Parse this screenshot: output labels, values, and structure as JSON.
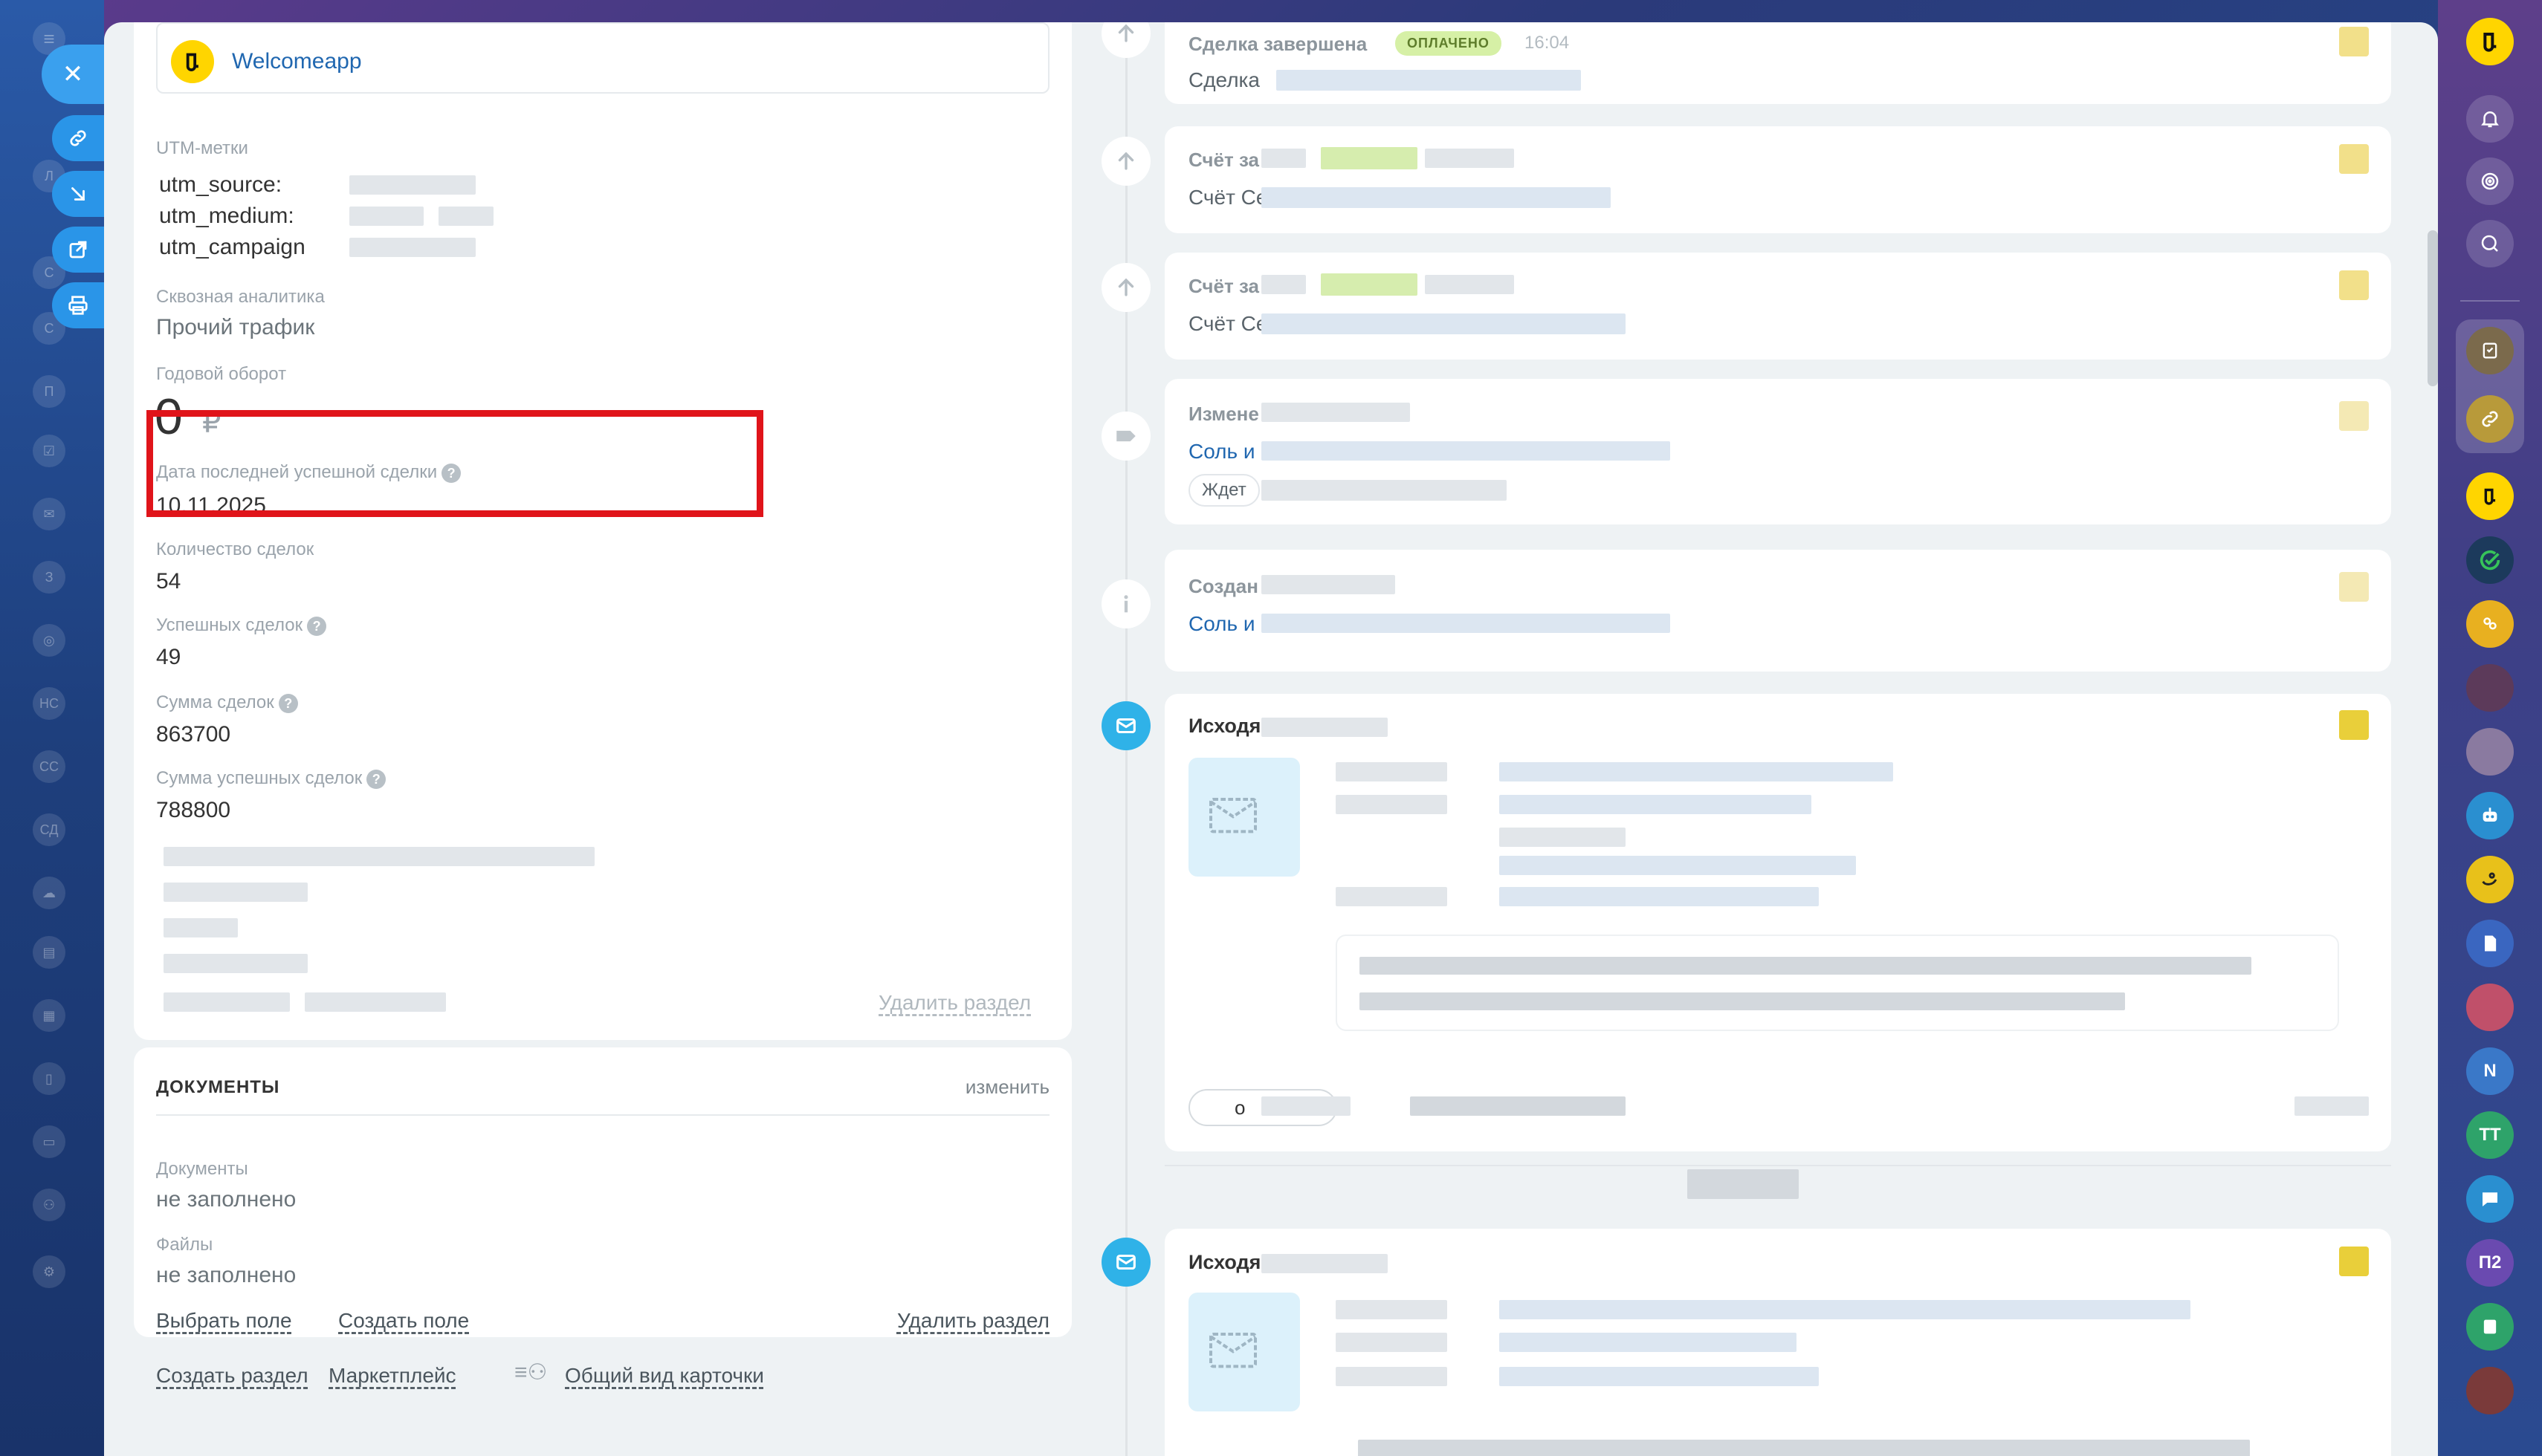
{
  "colors": {
    "accent": "#2fb2e8",
    "highlight": "#e0141a",
    "link": "#2067b0",
    "badge_bg": "#d6f0a6",
    "badge_text": "#5e7d2b"
  },
  "company": {
    "name": "Welcomeapp"
  },
  "utm": {
    "heading": "UTM-метки",
    "source_label": "utm_source:",
    "medium_label": "utm_medium:",
    "campaign_label": "utm_campaign"
  },
  "analytics": {
    "label": "Сквозная аналитика",
    "value": "Прочий трафик"
  },
  "turnover": {
    "label": "Годовой оборот",
    "value": "0",
    "currency": "₽"
  },
  "last_deal": {
    "label": "Дата последней успешной сделки",
    "value": "10.11.2025"
  },
  "deal_count": {
    "label": "Количество сделок",
    "value": "54"
  },
  "successful_deals": {
    "label": "Успешных сделок",
    "value": "49"
  },
  "deals_sum": {
    "label": "Сумма сделок",
    "value": "863700"
  },
  "successful_sum": {
    "label": "Сумма успешных сделок",
    "value": "788800"
  },
  "section_actions": {
    "delete_section": "Удалить раздел"
  },
  "documents": {
    "title": "ДОКУМЕНТЫ",
    "edit": "изменить",
    "docs_label": "Документы",
    "docs_value": "не заполнено",
    "files_label": "Файлы",
    "files_value": "не заполнено",
    "choose_field": "Выбрать поле",
    "create_field": "Создать поле",
    "delete_section": "Удалить раздел"
  },
  "footer_links": {
    "create_section": "Создать раздел",
    "marketplace": "Маркетплейс",
    "card_view": "Общий вид карточки"
  },
  "timeline": {
    "event1": {
      "title": "Сделка завершена",
      "badge": "ОПЛАЧЕНО",
      "time": "16:04",
      "text": "Сделка"
    },
    "event2": {
      "title": "Счёт за",
      "text": "Счёт Ce"
    },
    "event3": {
      "title": "Счёт за",
      "text": "Счёт Ce"
    },
    "event4": {
      "title": "Измене",
      "link": "Соль и",
      "chip": "Ждет"
    },
    "event5": {
      "title": "Создан",
      "link": "Соль и"
    },
    "event6": {
      "title": "Исходя",
      "button": "о"
    },
    "event7": {
      "title": "Исходя"
    }
  },
  "right_bar": {
    "items": [
      "N",
      "TT",
      "П2"
    ]
  },
  "left_strip": {
    "ghosts": [
      "Л",
      "С",
      "С",
      "П",
      "З",
      "НС",
      "СС",
      "СД"
    ]
  }
}
